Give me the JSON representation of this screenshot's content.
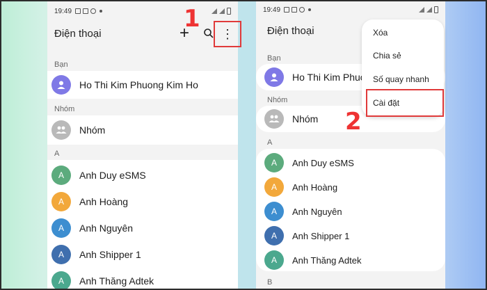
{
  "status": {
    "time": "19:49"
  },
  "app": {
    "title": "Điện thoại"
  },
  "toolbar": {
    "add": "+",
    "search": "⌕",
    "more": "⋮"
  },
  "sections": {
    "friends": "Bạn",
    "groups": "Nhóm",
    "a": "A",
    "b": "B"
  },
  "profile": {
    "name": "Ho Thi Kim Phuong Kim Ho",
    "name_truncated": "Ho Thi Kim Phuon"
  },
  "group": {
    "label": "Nhóm"
  },
  "contacts": [
    {
      "initial": "A",
      "name": "Anh Duy eSMS",
      "color": "#5cab7d"
    },
    {
      "initial": "A",
      "name": "Anh Hoàng",
      "color": "#f2a83b"
    },
    {
      "initial": "A",
      "name": "Anh Nguyên",
      "color": "#3d8ed0"
    },
    {
      "initial": "A",
      "name": "Anh Shipper 1",
      "color": "#3f6fae"
    },
    {
      "initial": "A",
      "name": "Anh Thăng Adtek",
      "color": "#4ba88e"
    }
  ],
  "menu": {
    "items": [
      "Xóa",
      "Chia sẻ",
      "Số quay nhanh",
      "Cài đặt"
    ]
  },
  "steps": {
    "one": "1",
    "two": "2"
  },
  "colors": {
    "highlight": "#e03a3a",
    "profile_avatar": "#7f79e6",
    "group_avatar": "#b9b9b9"
  }
}
